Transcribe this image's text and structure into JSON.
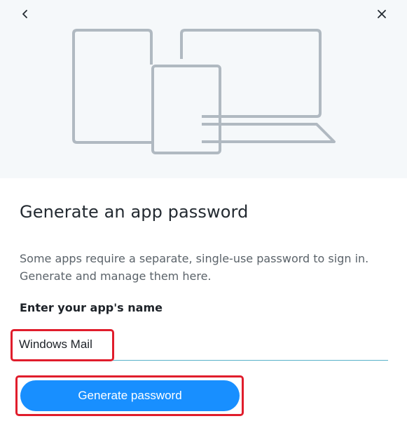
{
  "header": {
    "back_icon": "chevron-left-icon",
    "close_icon": "close-icon",
    "illustration": "devices-illustration",
    "illustration_color": "#b0b9c1"
  },
  "main": {
    "title": "Generate an app password",
    "description": "Some apps require a separate, single-use password to sign in. Generate and manage them here.",
    "field_label": "Enter your app's name",
    "field_value": "Windows Mail",
    "button_label": "Generate password"
  },
  "colors": {
    "accent": "#188fff",
    "highlight": "#e01d2c",
    "underline": "#57b2c8",
    "hero_background": "#f5f8fa"
  }
}
